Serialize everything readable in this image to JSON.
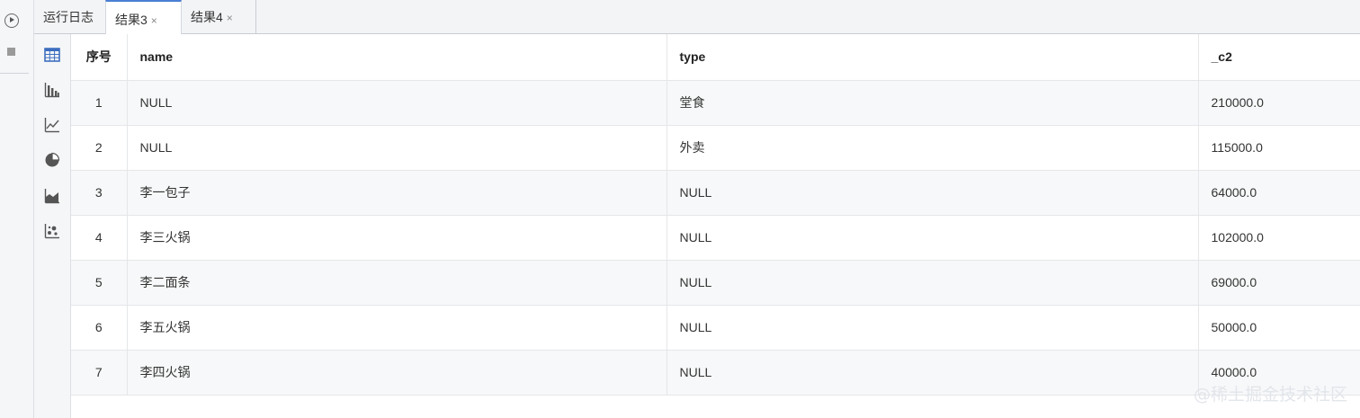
{
  "tabs": {
    "log": "运行日志",
    "result3": "结果3",
    "result4": "结果4",
    "close": "×"
  },
  "chart_types": [
    {
      "icon": "table-icon",
      "active": true
    },
    {
      "icon": "bar-chart-icon"
    },
    {
      "icon": "line-chart-icon"
    },
    {
      "icon": "pie-chart-icon"
    },
    {
      "icon": "area-chart-icon"
    },
    {
      "icon": "scatter-chart-icon"
    }
  ],
  "table": {
    "headers": [
      "序号",
      "name",
      "type",
      "_c2"
    ],
    "rows": [
      [
        "1",
        "NULL",
        "堂食",
        "210000.0"
      ],
      [
        "2",
        "NULL",
        "外卖",
        "115000.0"
      ],
      [
        "3",
        "李一包子",
        "NULL",
        "64000.0"
      ],
      [
        "4",
        "李三火锅",
        "NULL",
        "102000.0"
      ],
      [
        "5",
        "李二面条",
        "NULL",
        "69000.0"
      ],
      [
        "6",
        "李五火锅",
        "NULL",
        "50000.0"
      ],
      [
        "7",
        "李四火锅",
        "NULL",
        "40000.0"
      ]
    ]
  },
  "watermark": "@稀土掘金技术社区",
  "colors": {
    "accent": "#4a7fd4",
    "icon": "#3d6fbf"
  }
}
